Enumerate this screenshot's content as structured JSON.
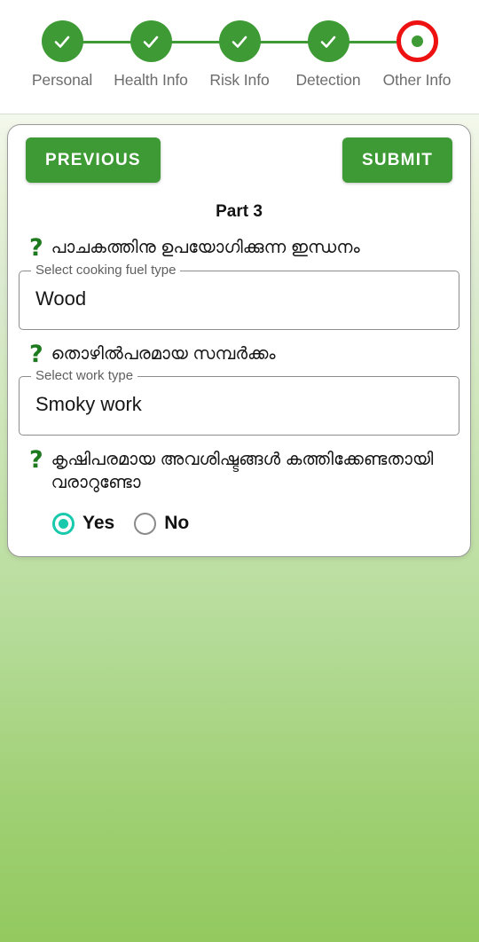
{
  "theme": {
    "primary_green": "#3d9a35",
    "current_step_ring": "#ee1111",
    "radio_accent": "#18c9ab",
    "question_icon_color": "#1e7a1e"
  },
  "stepper": {
    "steps": [
      {
        "label": "Personal",
        "state": "completed",
        "icon": "check-icon"
      },
      {
        "label": "Health Info",
        "state": "completed",
        "icon": "check-icon"
      },
      {
        "label": "Risk Info",
        "state": "completed",
        "icon": "check-icon"
      },
      {
        "label": "Detection",
        "state": "completed",
        "icon": "check-icon"
      },
      {
        "label": "Other Info",
        "state": "current",
        "icon": "dot-icon"
      }
    ]
  },
  "card": {
    "previous_label": "PREVIOUS",
    "submit_label": "SUBMIT",
    "part_title": "Part 3",
    "question_icon": "?",
    "questions": [
      {
        "text": "പാചകത്തിനു ഉപയോഗിക്കുന്ന ഇന്ധനം",
        "field": {
          "label": "Select cooking fuel type",
          "value": "Wood"
        }
      },
      {
        "text": "തൊഴിൽപരമായ സമ്പർക്കം",
        "field": {
          "label": "Select work type",
          "value": "Smoky work"
        }
      },
      {
        "text": "കൃഷിപരമായ അവശിഷ്ടങ്ങൾ കത്തിക്കേണ്ടതായി വരാറുണ്ടോ",
        "radio": {
          "options": [
            {
              "label": "Yes",
              "checked": true
            },
            {
              "label": "No",
              "checked": false
            }
          ]
        }
      }
    ]
  }
}
